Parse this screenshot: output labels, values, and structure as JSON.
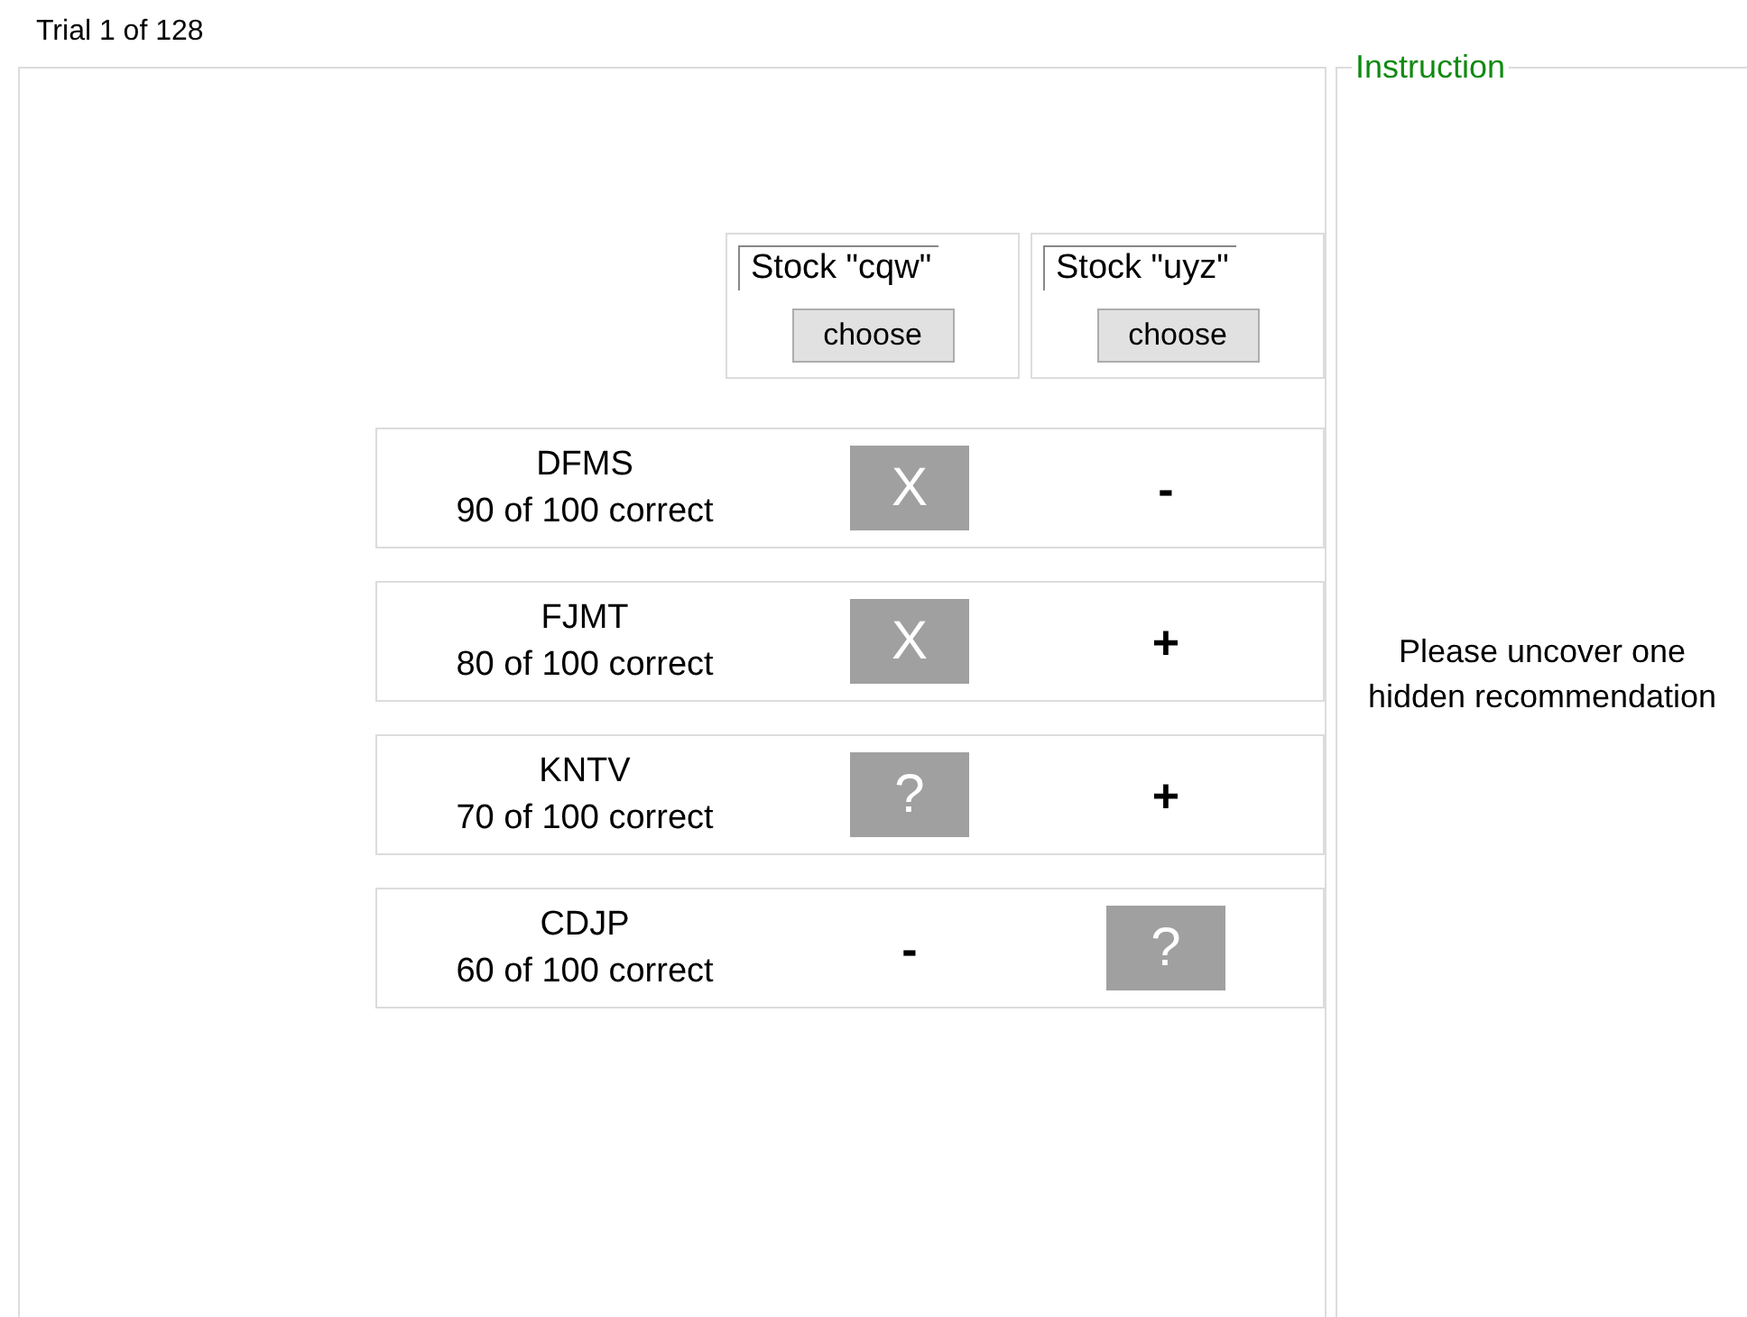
{
  "trial": "Trial 1 of 128",
  "stocks": [
    {
      "label": "Stock \"cqw\"",
      "button": "choose"
    },
    {
      "label": "Stock \"uyz\"",
      "button": "choose"
    }
  ],
  "advisors": [
    {
      "name": "DFMS",
      "accuracy": "90 of 100 correct",
      "cells": [
        {
          "kind": "covered",
          "text": "X"
        },
        {
          "kind": "plain",
          "text": "-"
        }
      ]
    },
    {
      "name": "FJMT",
      "accuracy": "80 of 100 correct",
      "cells": [
        {
          "kind": "covered",
          "text": "X"
        },
        {
          "kind": "plain",
          "text": "+"
        }
      ]
    },
    {
      "name": "KNTV",
      "accuracy": "70 of 100 correct",
      "cells": [
        {
          "kind": "covered",
          "text": "?"
        },
        {
          "kind": "plain",
          "text": "+"
        }
      ]
    },
    {
      "name": "CDJP",
      "accuracy": "60 of 100 correct",
      "cells": [
        {
          "kind": "plain",
          "text": "-"
        },
        {
          "kind": "covered",
          "text": "?"
        }
      ]
    }
  ],
  "instruction": {
    "title": "Instruction",
    "text": "Please uncover one hidden recommendation"
  }
}
